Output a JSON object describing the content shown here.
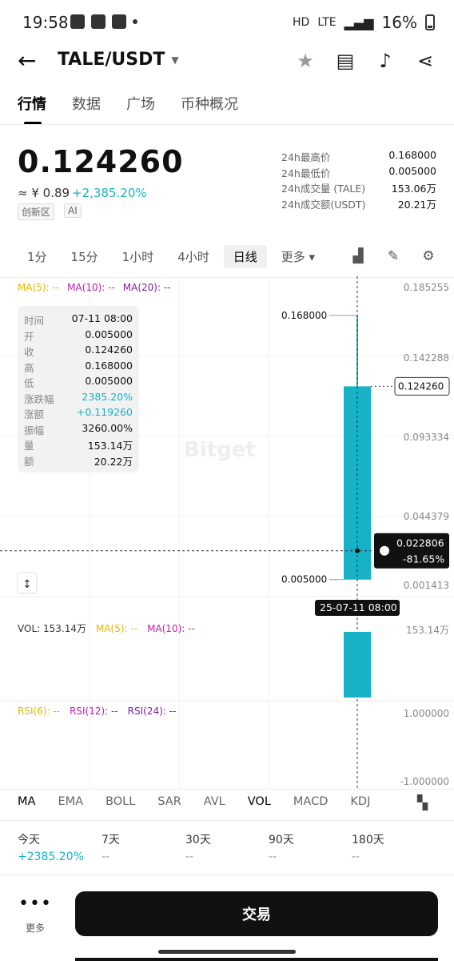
{
  "status": {
    "time": "19:58",
    "battery": "16%",
    "network": "LTE",
    "hd": "HD"
  },
  "header": {
    "pair": "TALE/USDT",
    "icons": [
      "back-arrow-icon",
      "star-icon",
      "book-icon",
      "bell-icon",
      "share-icon"
    ]
  },
  "tabs": [
    "行情",
    "数据",
    "广场",
    "币种概况"
  ],
  "price": {
    "last": "0.124260",
    "cny": "≈ ¥ 0.89",
    "change": "+2,385.20%",
    "tags": [
      "创新区",
      "AI"
    ]
  },
  "stats": [
    {
      "label": "24h最高价",
      "value": "0.168000"
    },
    {
      "label": "24h最低价",
      "value": "0.005000"
    },
    {
      "label": "24h成交量 (TALE)",
      "value": "153.06万"
    },
    {
      "label": "24h成交额(USDT)",
      "value": "20.21万"
    }
  ],
  "periods": [
    {
      "label": "1分"
    },
    {
      "label": "15分"
    },
    {
      "label": "1小时"
    },
    {
      "label": "4小时"
    },
    {
      "label": "日线"
    },
    {
      "label": "更多 ▾"
    }
  ],
  "ma_legend": {
    "ma5": "MA(5): --",
    "ma10": "MA(10): --",
    "ma20": "MA(20): --"
  },
  "info_panel": [
    {
      "label": "时间",
      "value": "07-11 08:00"
    },
    {
      "label": "开",
      "value": "0.005000"
    },
    {
      "label": "收",
      "value": "0.124260"
    },
    {
      "label": "高",
      "value": "0.168000"
    },
    {
      "label": "低",
      "value": "0.005000"
    },
    {
      "label": "涨跌幅",
      "value": "2385.20%"
    },
    {
      "label": "涨额",
      "value": "+0.119260"
    },
    {
      "label": "振幅",
      "value": "3260.00%"
    },
    {
      "label": "量",
      "value": "153.14万"
    },
    {
      "label": "额",
      "value": "20.22万"
    }
  ],
  "y_axis": [
    "0.185255",
    "0.142288",
    "0.093334",
    "0.044379",
    "0.001413"
  ],
  "candle": {
    "open": 0.005,
    "close": 0.12426,
    "high": 0.168,
    "low": 0.005,
    "high_label": "0.168000",
    "low_label": "0.005000",
    "last_label": "0.124260"
  },
  "crosshair": {
    "price": "0.022806",
    "pct": "-81.65%",
    "time": "25-07-11 08:00"
  },
  "watermark": "Bitget",
  "vol": {
    "legend": "VOL: 153.14万",
    "ma5": "MA(5): --",
    "ma10": "MA(10): --",
    "axis": "153.14万",
    "value": 153.14
  },
  "rsi": {
    "rsi6": "RSI(6): --",
    "rsi12": "RSI(12): --",
    "rsi24": "RSI(24): --",
    "axis_top": "1.000000",
    "axis_bottom": "-1.000000"
  },
  "indicator_tabs": [
    "MA",
    "EMA",
    "BOLL",
    "SAR",
    "AVL",
    "VOL",
    "MACD",
    "KDJ"
  ],
  "performance": [
    {
      "label": "今天",
      "value": "+2385.20%"
    },
    {
      "label": "7天",
      "value": "--"
    },
    {
      "label": "30天",
      "value": "--"
    },
    {
      "label": "90天",
      "value": "--"
    },
    {
      "label": "180天",
      "value": "--"
    }
  ],
  "footer": {
    "more": "更多",
    "trade": "交易"
  },
  "colors": {
    "accent": "#17b2c6",
    "ma5": "#e6b800",
    "ma10": "#c21bb4",
    "ma20": "#7b1fa2"
  }
}
